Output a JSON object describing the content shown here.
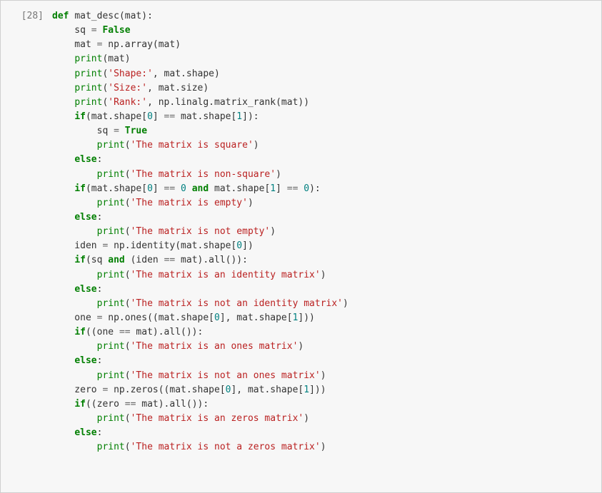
{
  "cell": {
    "prompt": "[28]",
    "lines": [
      [
        {
          "t": "def ",
          "c": "kw"
        },
        {
          "t": "mat_desc",
          "c": "fn"
        },
        {
          "t": "(mat):"
        }
      ],
      [
        {
          "t": "    sq "
        },
        {
          "t": "=",
          "c": "op"
        },
        {
          "t": " "
        },
        {
          "t": "False",
          "c": "bl"
        }
      ],
      [
        {
          "t": "    mat "
        },
        {
          "t": "=",
          "c": "op"
        },
        {
          "t": " np.array(mat)"
        }
      ],
      [
        {
          "t": "    "
        },
        {
          "t": "print",
          "c": "bltn"
        },
        {
          "t": "(mat)"
        }
      ],
      [
        {
          "t": "    "
        },
        {
          "t": "print",
          "c": "bltn"
        },
        {
          "t": "("
        },
        {
          "t": "'Shape:'",
          "c": "str"
        },
        {
          "t": ", mat.shape)"
        }
      ],
      [
        {
          "t": "    "
        },
        {
          "t": "print",
          "c": "bltn"
        },
        {
          "t": "("
        },
        {
          "t": "'Size:'",
          "c": "str"
        },
        {
          "t": ", mat.size)"
        }
      ],
      [
        {
          "t": "    "
        },
        {
          "t": "print",
          "c": "bltn"
        },
        {
          "t": "("
        },
        {
          "t": "'Rank:'",
          "c": "str"
        },
        {
          "t": ", np.linalg.matrix_rank(mat))"
        }
      ],
      [
        {
          "t": "    "
        },
        {
          "t": "if",
          "c": "kw"
        },
        {
          "t": "(mat.shape["
        },
        {
          "t": "0",
          "c": "num"
        },
        {
          "t": "] "
        },
        {
          "t": "==",
          "c": "op"
        },
        {
          "t": " mat.shape["
        },
        {
          "t": "1",
          "c": "num"
        },
        {
          "t": "]):"
        }
      ],
      [
        {
          "t": "        sq "
        },
        {
          "t": "=",
          "c": "op"
        },
        {
          "t": " "
        },
        {
          "t": "True",
          "c": "bl"
        }
      ],
      [
        {
          "t": "        "
        },
        {
          "t": "print",
          "c": "bltn"
        },
        {
          "t": "("
        },
        {
          "t": "'The matrix is square'",
          "c": "str"
        },
        {
          "t": ")"
        }
      ],
      [
        {
          "t": "    "
        },
        {
          "t": "else",
          "c": "kw"
        },
        {
          "t": ":"
        }
      ],
      [
        {
          "t": "        "
        },
        {
          "t": "print",
          "c": "bltn"
        },
        {
          "t": "("
        },
        {
          "t": "'The matrix is non-square'",
          "c": "str"
        },
        {
          "t": ")"
        }
      ],
      [
        {
          "t": "    "
        },
        {
          "t": "if",
          "c": "kw"
        },
        {
          "t": "(mat.shape["
        },
        {
          "t": "0",
          "c": "num"
        },
        {
          "t": "] "
        },
        {
          "t": "==",
          "c": "op"
        },
        {
          "t": " "
        },
        {
          "t": "0",
          "c": "num"
        },
        {
          "t": " "
        },
        {
          "t": "and",
          "c": "kw"
        },
        {
          "t": " mat.shape["
        },
        {
          "t": "1",
          "c": "num"
        },
        {
          "t": "] "
        },
        {
          "t": "==",
          "c": "op"
        },
        {
          "t": " "
        },
        {
          "t": "0",
          "c": "num"
        },
        {
          "t": "):"
        }
      ],
      [
        {
          "t": "        "
        },
        {
          "t": "print",
          "c": "bltn"
        },
        {
          "t": "("
        },
        {
          "t": "'The matrix is empty'",
          "c": "str"
        },
        {
          "t": ")"
        }
      ],
      [
        {
          "t": "    "
        },
        {
          "t": "else",
          "c": "kw"
        },
        {
          "t": ":"
        }
      ],
      [
        {
          "t": "        "
        },
        {
          "t": "print",
          "c": "bltn"
        },
        {
          "t": "("
        },
        {
          "t": "'The matrix is not empty'",
          "c": "str"
        },
        {
          "t": ")"
        }
      ],
      [
        {
          "t": "    iden "
        },
        {
          "t": "=",
          "c": "op"
        },
        {
          "t": " np.identity(mat.shape["
        },
        {
          "t": "0",
          "c": "num"
        },
        {
          "t": "])"
        }
      ],
      [
        {
          "t": "    "
        },
        {
          "t": "if",
          "c": "kw"
        },
        {
          "t": "(sq "
        },
        {
          "t": "and",
          "c": "kw"
        },
        {
          "t": " (iden "
        },
        {
          "t": "==",
          "c": "op"
        },
        {
          "t": " mat).all()):"
        }
      ],
      [
        {
          "t": "        "
        },
        {
          "t": "print",
          "c": "bltn"
        },
        {
          "t": "("
        },
        {
          "t": "'The matrix is an identity matrix'",
          "c": "str"
        },
        {
          "t": ")"
        }
      ],
      [
        {
          "t": "    "
        },
        {
          "t": "else",
          "c": "kw"
        },
        {
          "t": ":"
        }
      ],
      [
        {
          "t": "        "
        },
        {
          "t": "print",
          "c": "bltn"
        },
        {
          "t": "("
        },
        {
          "t": "'The matrix is not an identity matrix'",
          "c": "str"
        },
        {
          "t": ")"
        }
      ],
      [
        {
          "t": "    one "
        },
        {
          "t": "=",
          "c": "op"
        },
        {
          "t": " np.ones((mat.shape["
        },
        {
          "t": "0",
          "c": "num"
        },
        {
          "t": "], mat.shape["
        },
        {
          "t": "1",
          "c": "num"
        },
        {
          "t": "]))"
        }
      ],
      [
        {
          "t": "    "
        },
        {
          "t": "if",
          "c": "kw"
        },
        {
          "t": "((one "
        },
        {
          "t": "==",
          "c": "op"
        },
        {
          "t": " mat).all()):"
        }
      ],
      [
        {
          "t": "        "
        },
        {
          "t": "print",
          "c": "bltn"
        },
        {
          "t": "("
        },
        {
          "t": "'The matrix is an ones matrix'",
          "c": "str"
        },
        {
          "t": ")"
        }
      ],
      [
        {
          "t": "    "
        },
        {
          "t": "else",
          "c": "kw"
        },
        {
          "t": ":"
        }
      ],
      [
        {
          "t": "        "
        },
        {
          "t": "print",
          "c": "bltn"
        },
        {
          "t": "("
        },
        {
          "t": "'The matrix is not an ones matrix'",
          "c": "str"
        },
        {
          "t": ")"
        }
      ],
      [
        {
          "t": "    zero "
        },
        {
          "t": "=",
          "c": "op"
        },
        {
          "t": " np.zeros((mat.shape["
        },
        {
          "t": "0",
          "c": "num"
        },
        {
          "t": "], mat.shape["
        },
        {
          "t": "1",
          "c": "num"
        },
        {
          "t": "]))"
        }
      ],
      [
        {
          "t": "    "
        },
        {
          "t": "if",
          "c": "kw"
        },
        {
          "t": "((zero "
        },
        {
          "t": "==",
          "c": "op"
        },
        {
          "t": " mat).all()):"
        }
      ],
      [
        {
          "t": "        "
        },
        {
          "t": "print",
          "c": "bltn"
        },
        {
          "t": "("
        },
        {
          "t": "'The matrix is an zeros matrix'",
          "c": "str"
        },
        {
          "t": ")"
        }
      ],
      [
        {
          "t": "    "
        },
        {
          "t": "else",
          "c": "kw"
        },
        {
          "t": ":"
        }
      ],
      [
        {
          "t": "        "
        },
        {
          "t": "print",
          "c": "bltn"
        },
        {
          "t": "("
        },
        {
          "t": "'The matrix is not a zeros matrix'",
          "c": "str"
        },
        {
          "t": ")"
        }
      ]
    ]
  }
}
